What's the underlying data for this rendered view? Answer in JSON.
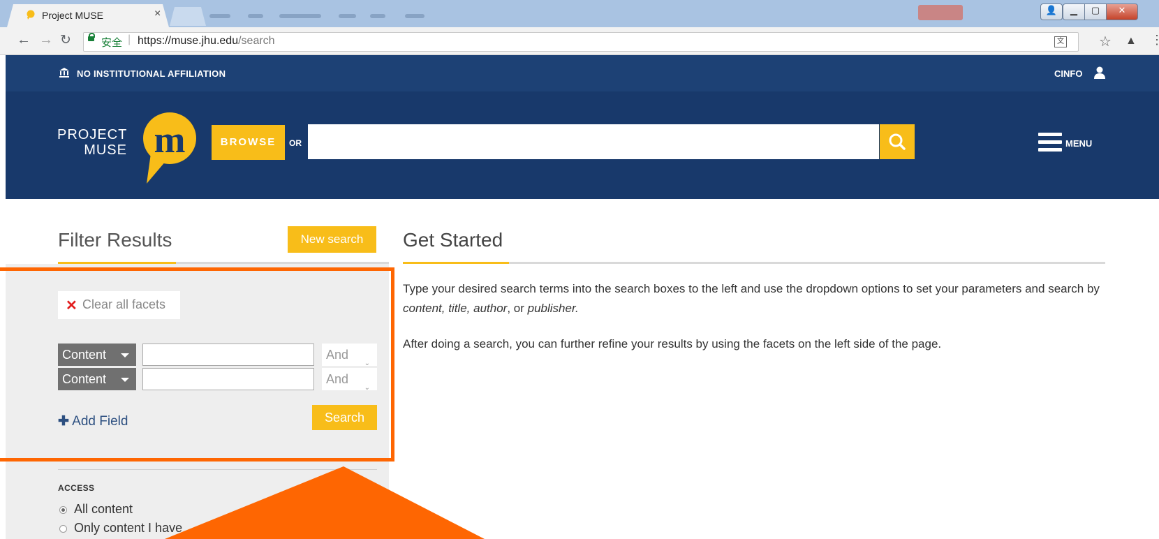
{
  "browser": {
    "tab_title": "Project MUSE",
    "tab_close": "×",
    "secure_label": "安全",
    "url_host": "https://muse.jhu.edu",
    "url_path": "/search"
  },
  "topbar": {
    "affiliation": "NO INSTITUTIONAL AFFILIATION",
    "user": "CINFO"
  },
  "header": {
    "logo_line1": "PROJECT",
    "logo_line2": "MUSE",
    "browse_label": "BROWSE",
    "or_label": "OR",
    "search_value": "",
    "menu_label": "MENU"
  },
  "filter": {
    "title": "Filter Results",
    "new_search_label": "New search",
    "clear_label": "Clear all facets",
    "rows": [
      {
        "field": "Content",
        "value": "",
        "bool": "And"
      },
      {
        "field": "Content",
        "value": "",
        "bool": "And"
      }
    ],
    "add_field_label": "Add Field",
    "search_label": "Search",
    "access_heading": "ACCESS",
    "access_options": [
      "All content",
      "Only content I have"
    ],
    "access_selected": "All content"
  },
  "main": {
    "title": "Get Started",
    "para1_a": "Type your desired search terms into the search boxes to the left and use the dropdown options to set your parameters and search by ",
    "para1_content": "content, title, author",
    "para1_b": ", or ",
    "para1_publisher": "publisher.",
    "para2": "After doing a search, you can further refine your results by using the facets on the left side of the page."
  },
  "colors": {
    "brand_navy": "#18396b",
    "brand_gold": "#f8bd19",
    "highlight_orange": "#fe6602"
  }
}
